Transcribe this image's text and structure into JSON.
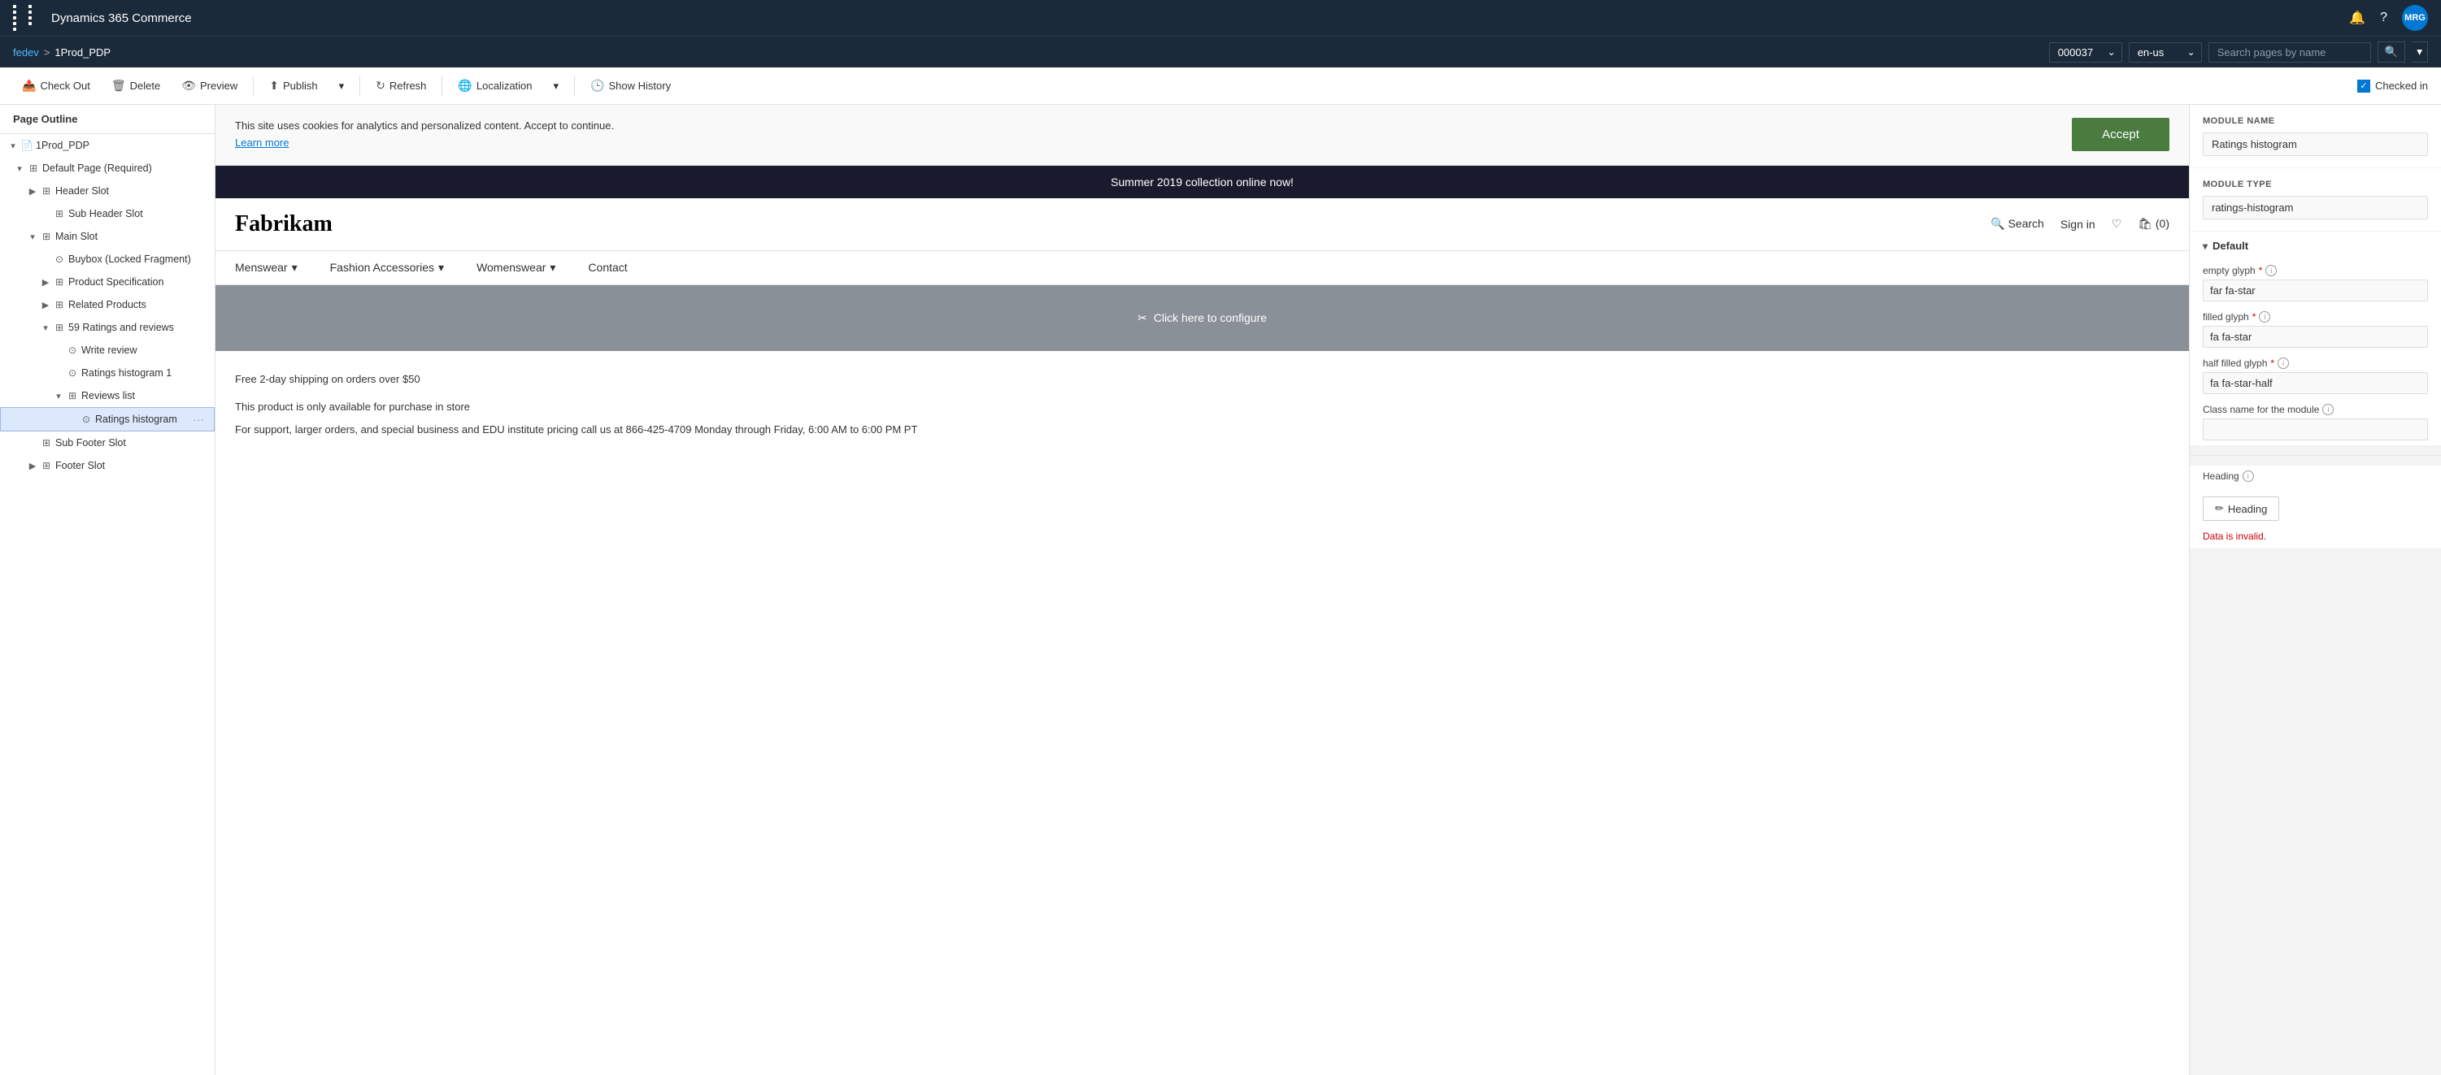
{
  "app": {
    "title": "Dynamics 365 Commerce",
    "avatar": "MRG"
  },
  "breadcrumb": {
    "link": "fedev",
    "separator": ">",
    "current": "1Prod_PDP"
  },
  "dropdowns": {
    "store": "000037",
    "locale": "en-us"
  },
  "search": {
    "placeholder": "Search pages by name"
  },
  "toolbar": {
    "checkout": "Check Out",
    "delete": "Delete",
    "preview": "Preview",
    "publish": "Publish",
    "refresh": "Refresh",
    "localization": "Localization",
    "show_history": "Show History",
    "checked_in": "Checked in"
  },
  "page_outline": {
    "header": "Page Outline",
    "tree": [
      {
        "level": 1,
        "label": "1Prod_PDP",
        "type": "page",
        "expanded": true,
        "indent": 0
      },
      {
        "level": 2,
        "label": "Default Page (Required)",
        "type": "container",
        "expanded": true,
        "indent": 1
      },
      {
        "level": 3,
        "label": "Header Slot",
        "type": "slot",
        "expanded": false,
        "indent": 2
      },
      {
        "level": 4,
        "label": "Sub Header Slot",
        "type": "module",
        "indent": 3
      },
      {
        "level": 3,
        "label": "Main Slot",
        "type": "slot",
        "expanded": true,
        "indent": 2
      },
      {
        "level": 4,
        "label": "Buybox (Locked Fragment)",
        "type": "locked",
        "indent": 3
      },
      {
        "level": 4,
        "label": "Product Specification",
        "type": "container",
        "expanded": false,
        "indent": 3
      },
      {
        "level": 4,
        "label": "Related Products",
        "type": "container",
        "expanded": false,
        "indent": 3
      },
      {
        "level": 4,
        "label": "Ratings and reviews",
        "type": "container",
        "expanded": true,
        "indent": 3
      },
      {
        "level": 5,
        "label": "Write review",
        "type": "module",
        "indent": 4
      },
      {
        "level": 5,
        "label": "Ratings histogram 1",
        "type": "module",
        "indent": 4
      },
      {
        "level": 5,
        "label": "Reviews list",
        "type": "container",
        "expanded": true,
        "indent": 4
      },
      {
        "level": 6,
        "label": "Ratings histogram",
        "type": "module",
        "indent": 5,
        "selected": true
      }
    ],
    "tree_after": [
      {
        "level": 3,
        "label": "Sub Footer Slot",
        "type": "slot",
        "indent": 2
      },
      {
        "level": 3,
        "label": "Footer Slot",
        "type": "slot",
        "expanded": false,
        "indent": 2
      }
    ]
  },
  "canvas": {
    "cookie_banner": {
      "text": "This site uses cookies for analytics and personalized content. Accept to continue.",
      "learn_more": "Learn more",
      "accept_btn": "Accept"
    },
    "promo_banner": "Summer 2019 collection online now!",
    "store_logo": "Fabrikam",
    "nav_search": "Search",
    "nav_signin": "Sign in",
    "nav_cart": "(0)",
    "menu_items": [
      "Menswear",
      "Fashion Accessories",
      "Womenswear",
      "Contact"
    ],
    "configure_text": "Click here to configure",
    "product_info": {
      "shipping": "Free 2-day shipping on orders over $50",
      "store_only": "This product is only available for purchase in store",
      "support": "For support, larger orders, and special business and EDU institute pricing call us at 866-425-4709 Monday through Friday, 6:00 AM to 6:00 PM PT"
    }
  },
  "right_panel": {
    "module_name_label": "MODULE NAME",
    "module_name_value": "Ratings histogram",
    "module_type_label": "Module Type",
    "module_type_value": "ratings-histogram",
    "default_section": "Default",
    "empty_glyph_label": "empty glyph",
    "empty_glyph_value": "far fa-star",
    "filled_glyph_label": "filled glyph",
    "filled_glyph_value": "fa fa-star",
    "half_filled_glyph_label": "half filled glyph",
    "half_filled_glyph_value": "fa fa-star-half",
    "class_name_label": "Class name for the module",
    "heading_label": "Heading",
    "heading_btn": "Heading",
    "data_invalid": "Data is invalid."
  }
}
